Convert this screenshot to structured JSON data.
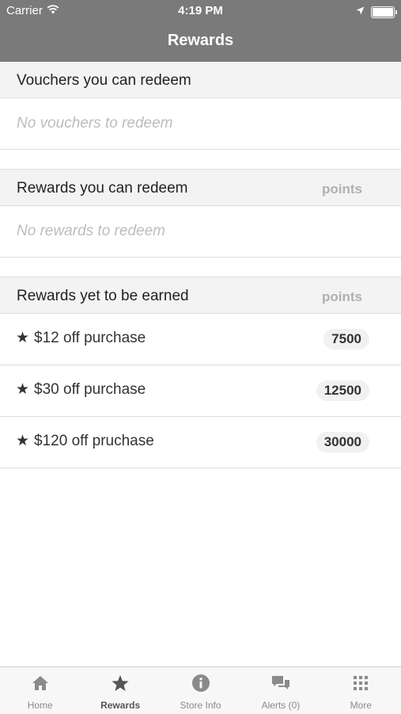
{
  "status_bar": {
    "carrier": "Carrier",
    "time": "4:19 PM"
  },
  "nav": {
    "title": "Rewards"
  },
  "sections": {
    "vouchers": {
      "title": "Vouchers you can redeem",
      "empty_text": "No vouchers to redeem"
    },
    "redeemable": {
      "title": "Rewards you can redeem",
      "points_header": "points",
      "empty_text": "No rewards to redeem"
    },
    "to_earn": {
      "title": "Rewards yet to be earned",
      "points_header": "points",
      "items": [
        {
          "star": "★",
          "label": "$12 off purchase",
          "points": "7500"
        },
        {
          "star": "★",
          "label": "$30 off purchase",
          "points": "12500"
        },
        {
          "star": "★",
          "label": "$120 off pruchase",
          "points": "30000"
        }
      ]
    }
  },
  "tabbar": {
    "tabs": [
      {
        "label": "Home",
        "icon": "home-icon"
      },
      {
        "label": "Rewards",
        "icon": "star-icon",
        "active": true
      },
      {
        "label": "Store Info",
        "icon": "info-icon"
      },
      {
        "label": "Alerts (0)",
        "icon": "chat-bubbles-icon"
      },
      {
        "label": "More",
        "icon": "grid-dots-icon"
      }
    ]
  },
  "colors": {
    "nav_background": "#7a7a7a",
    "section_header_background": "#f3f3f3",
    "placeholder_text": "#bdbdbd",
    "active_tab": "#555555",
    "inactive_tab": "#8a8a8a"
  }
}
